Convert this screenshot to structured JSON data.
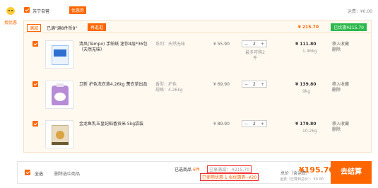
{
  "store": {
    "avatar_label": "找优惠",
    "name": "苏宁自营",
    "badge": "优惠券",
    "freight": "运费：¥0.00"
  },
  "promo": {
    "tag": "满减",
    "text": "已满\"满8件折8\"",
    "link": "再逛逛",
    "sum": "¥ 215.70",
    "discount": "已优惠¥215.70"
  },
  "items": [
    {
      "name": "清风(Tempo) 手帕纸 迷你4层*36包（天然无味）",
      "spec": "系列：天然无味",
      "price": "¥ 55.90",
      "qty": "2",
      "qty_note": "最多可购2件",
      "subtotal": "¥ 111.80",
      "weight": "1.46kg",
      "ops": [
        "移入收藏",
        "删除"
      ]
    },
    {
      "name": "卫新 护色洗衣液4.26kg 薰衣草出品",
      "spec": "香型：护色\n规格：4.26kg",
      "price": "¥ 69.90",
      "qty": "2",
      "qty_note": "",
      "subtotal": "¥ 139.80",
      "weight": "9kg",
      "ops": [
        "移入收藏",
        "删除"
      ]
    },
    {
      "name": "金龙鱼乳玉皇妃稻香贡米 5kg袋装",
      "spec": "",
      "price": "¥ 89.90",
      "qty": "2",
      "qty_note": "",
      "subtotal": "¥ 179.80",
      "weight": "10.2kg",
      "ops": [
        "移入收藏",
        "删除"
      ]
    }
  ],
  "bottom": {
    "select_all": "全选",
    "delete_selected": "删除选中商品",
    "chosen_label": "已选商品",
    "chosen_count": "6件",
    "saved": "已享满减：-¥215.70",
    "coupon": "已使用优惠 1 张优惠券 -¥20",
    "total_label": "总价（含运费）",
    "total": "¥195.70",
    "total_sub": "运费（已算到总价）：¥0.00",
    "checkout": "去结算"
  },
  "colors": {
    "accent": "#ff6600",
    "promo_green": "#2db84d",
    "panel_bg": "#fff9f0"
  }
}
